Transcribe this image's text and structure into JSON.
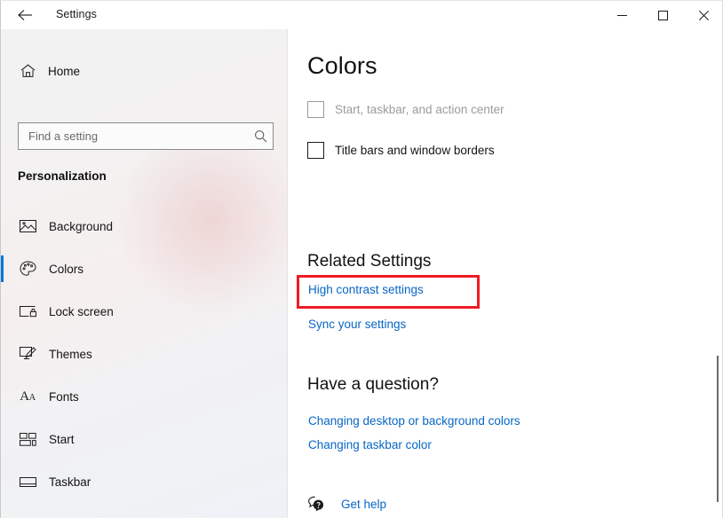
{
  "window": {
    "app_title": "Settings",
    "back_icon": "back-arrow-icon",
    "minimize_icon": "minimize-icon",
    "maximize_icon": "maximize-icon",
    "close_icon": "close-icon"
  },
  "sidebar": {
    "home": {
      "label": "Home",
      "icon": "home-icon"
    },
    "search": {
      "placeholder": "Find a setting",
      "value": "",
      "icon": "search-icon"
    },
    "section_title": "Personalization",
    "items": [
      {
        "label": "Background",
        "icon": "image-icon",
        "selected": false
      },
      {
        "label": "Colors",
        "icon": "palette-icon",
        "selected": true
      },
      {
        "label": "Lock screen",
        "icon": "lock-screen-icon",
        "selected": false
      },
      {
        "label": "Themes",
        "icon": "monitor-brush-icon",
        "selected": false
      },
      {
        "label": "Fonts",
        "icon": "fonts-aa-icon",
        "selected": false
      },
      {
        "label": "Start",
        "icon": "start-tiles-icon",
        "selected": false
      },
      {
        "label": "Taskbar",
        "icon": "taskbar-icon",
        "selected": false
      }
    ]
  },
  "main": {
    "page_title": "Colors",
    "checkboxes": [
      {
        "label": "Start, taskbar, and action center",
        "checked": false,
        "disabled": true
      },
      {
        "label": "Title bars and window borders",
        "checked": false,
        "disabled": false
      }
    ],
    "related_settings": {
      "heading": "Related Settings",
      "links": [
        {
          "label": "High contrast settings",
          "highlighted": true
        },
        {
          "label": "Sync your settings",
          "highlighted": false
        }
      ]
    },
    "have_a_question": {
      "heading": "Have a question?",
      "links": [
        {
          "label": "Changing desktop or background colors"
        },
        {
          "label": "Changing taskbar color"
        }
      ]
    },
    "get_help": {
      "label": "Get help",
      "icon": "help-bubble-icon"
    }
  },
  "colors": {
    "accent": "#0078d7",
    "link": "#0866c6",
    "highlight_box": "#ee1c25",
    "sidebar_bg": "#f2f2f2",
    "content_bg": "#ffffff",
    "disabled_text": "#9b9b9b"
  },
  "scrollbar": {
    "name": "content-scrollbar"
  }
}
